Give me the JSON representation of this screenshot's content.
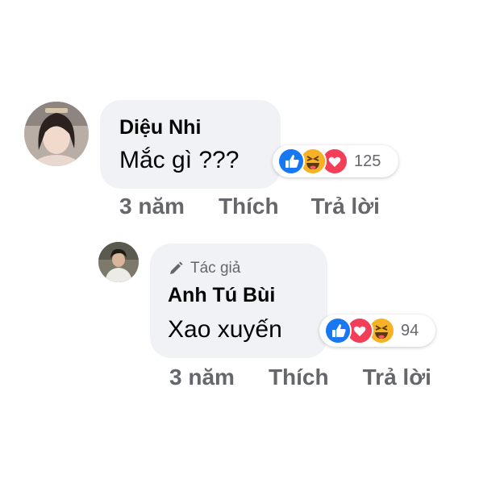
{
  "comments": [
    {
      "author": "Diệu Nhi",
      "text": "Mắc gì ???",
      "reactions": [
        "like",
        "haha",
        "love"
      ],
      "reaction_count": "125",
      "time": "3 năm",
      "like_label": "Thích",
      "reply_label": "Trả lời"
    },
    {
      "badge": "Tác giả",
      "author": "Anh Tú Bùi",
      "text": "Xao xuyến",
      "reactions": [
        "like",
        "love",
        "haha"
      ],
      "reaction_count": "94",
      "time": "3 năm",
      "like_label": "Thích",
      "reply_label": "Trả lời"
    }
  ],
  "colors": {
    "bubble": "#f0f2f5",
    "like": "#1877f2",
    "love": "#f33e58",
    "haha": "#f7b125",
    "meta_text": "#65676b"
  }
}
